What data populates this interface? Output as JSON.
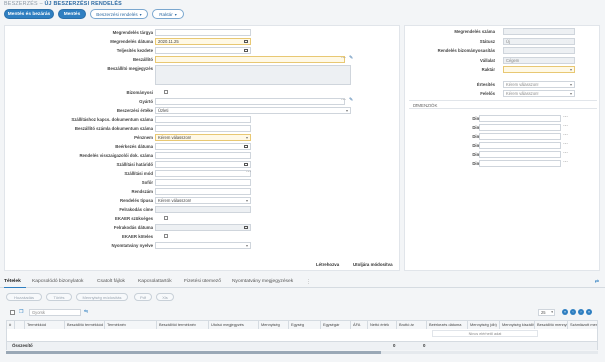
{
  "header": {
    "breadcrumb": "BESZERZÉS",
    "title": "ÚJ BESZERZÉSI RENDELÉS",
    "buttons": {
      "save_close": "Mentés és bezárás",
      "save": "Mentés",
      "order_types": "Beszerzési rendelés",
      "warehouse": "Raktár"
    }
  },
  "form": {
    "subject_label": "Megrendelés tárgya",
    "order_date_label": "Megrendelés dátuma",
    "order_date_value": "2020.11.25",
    "completion_date_label": "Teljesítés kezdete",
    "supplier_label": "Beszállító",
    "supplier_note_label": "Beszállító megjegyzés",
    "consignment_label": "Bizományosi",
    "manufacturer_label": "Gyártó",
    "purchase_value_label": "Beszerzési értéke",
    "purchase_value_value": "Üzleti",
    "delivery_doc_label": "Szállításhoz kapcs. dokumentum száma",
    "supplier_invoice_label": "Beszállító számla dokumentum száma",
    "currency_label": "Pénznem",
    "currency_value": "Kérem válasszon!",
    "receipt_date_label": "Beérkezés dátuma",
    "confirmation_no_label": "Rendelés visszaigazolói dok. száma",
    "delivery_deadline_label": "Szállítási határidő",
    "delivery_mode_label": "Szállítási mód",
    "subject2_label": "Sofőr",
    "license_plate_label": "Rendszám",
    "order_type_label": "Rendelés típusa",
    "order_type_value": "Kérem válasszon!",
    "unload_address_label": "Felrakodás címe",
    "ekaer_required_label": "EKAER szükséges",
    "unload_date_label": "Felrakodás dátuma",
    "ekaer_mandatory_label": "EKAER köteles",
    "print_language_label": "Nyomtatvány nyelve",
    "link_back": "Létrehozva",
    "link_modified": "Utoljára módosítva"
  },
  "right_panel": {
    "order_no_label": "Megrendelés száma",
    "status_label": "Státusz",
    "status_value": "Új",
    "consignment_stock_label": "Rendelés bizományosasítás",
    "company_label": "Vállalat",
    "company_value": "Cégem",
    "warehouse_label": "Raktár",
    "notified_label": "Értesítés",
    "notified_value": "Kérem válasszon!",
    "responsible_label": "Felelős",
    "responsible_value": "Kérem válasszon!",
    "dimensions_title": "DIMENZIÓK",
    "dimensions": [
      "Dimenzió 1",
      "Dimenzió 2",
      "Dimenzió 3",
      "Dimenzió 4",
      "Dimenzió 5",
      "Dimenzió 6"
    ]
  },
  "tabs": {
    "items": [
      "Tételek",
      "Kapcsolódó bizonylatok",
      "Csatolt fájlok",
      "Kapcsolattartók",
      "Fizetési ütemező",
      "Nyomtatvány megjegyzések"
    ],
    "more": "⋮"
  },
  "subbuttons": [
    "Hozzáadás",
    "Törlés",
    "Mennyiség módosítás",
    "Pdf",
    "Xls"
  ],
  "grid_toolbar": {
    "search_placeholder": "Gyorsk",
    "page_size": "25"
  },
  "grid": {
    "columns": [
      "#",
      "Termékkód",
      "Beszállító termékkód",
      "Terméknév",
      "Beszállítói terméknév",
      "Utolsó megjegyzés",
      "Mennyiség",
      "Egység",
      "Egységár",
      "ÁFA",
      "Nettó érték",
      "Bruttó ár",
      "Beérkezés dátuma",
      "Mennyiség (db)",
      "Mennyiség kiszállítva",
      "Beszállító mennyiség",
      "Számlázott mennyiség"
    ],
    "no_data": "Nincs elérhető adat",
    "footer_label": "Összesítő",
    "footer_net": "0",
    "footer_gross": "0"
  }
}
